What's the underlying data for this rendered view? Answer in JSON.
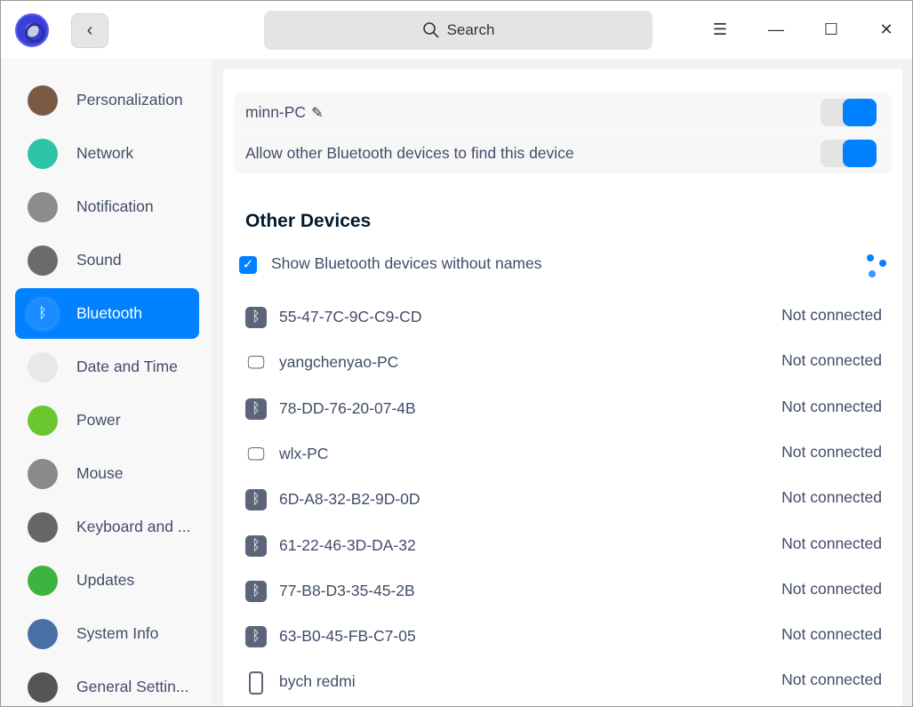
{
  "header": {
    "search_placeholder": "Search",
    "back": "‹",
    "menu": "☰",
    "minimize": "—",
    "maximize": "☐",
    "close": "✕"
  },
  "sidebar": {
    "items": [
      {
        "label": "Personalization",
        "icon": "personalization-icon",
        "color": "#7b5a44"
      },
      {
        "label": "Network",
        "icon": "network-icon",
        "color": "#2cc5a8"
      },
      {
        "label": "Notification",
        "icon": "notification-icon",
        "color": "#8c8c8c"
      },
      {
        "label": "Sound",
        "icon": "sound-icon",
        "color": "#6b6b6b"
      },
      {
        "label": "Bluetooth",
        "icon": "bluetooth-icon",
        "color": "#1a8cff"
      },
      {
        "label": "Date and Time",
        "icon": "clock-icon",
        "color": "#e8e8e8"
      },
      {
        "label": "Power",
        "icon": "battery-icon",
        "color": "#6cc62e"
      },
      {
        "label": "Mouse",
        "icon": "mouse-icon",
        "color": "#8a8a8a"
      },
      {
        "label": "Keyboard and ...",
        "icon": "keyboard-icon",
        "color": "#666666"
      },
      {
        "label": "Updates",
        "icon": "updates-icon",
        "color": "#3fb33f"
      },
      {
        "label": "System Info",
        "icon": "system-info-icon",
        "color": "#4a6fa5"
      },
      {
        "label": "General Settin...",
        "icon": "general-settings-icon",
        "color": "#555555"
      }
    ],
    "selected": 4
  },
  "bluetooth": {
    "device_name": "minn-PC",
    "name_enabled": true,
    "discoverable_label": "Allow other Bluetooth devices to find this device",
    "discoverable": true,
    "other_devices_title": "Other Devices",
    "show_unnamed_label": "Show Bluetooth devices without names",
    "show_unnamed": true,
    "devices": [
      {
        "name": "55-47-7C-9C-C9-CD",
        "type": "bluetooth",
        "status": "Not connected"
      },
      {
        "name": "yangchenyao-PC",
        "type": "computer",
        "status": "Not connected"
      },
      {
        "name": "78-DD-76-20-07-4B",
        "type": "bluetooth",
        "status": "Not connected"
      },
      {
        "name": "wlx-PC",
        "type": "computer",
        "status": "Not connected"
      },
      {
        "name": "6D-A8-32-B2-9D-0D",
        "type": "bluetooth",
        "status": "Not connected"
      },
      {
        "name": "61-22-46-3D-DA-32",
        "type": "bluetooth",
        "status": "Not connected"
      },
      {
        "name": "77-B8-D3-35-45-2B",
        "type": "bluetooth",
        "status": "Not connected"
      },
      {
        "name": "63-B0-45-FB-C7-05",
        "type": "bluetooth",
        "status": "Not connected"
      },
      {
        "name": "bych redmi",
        "type": "phone",
        "status": "Not connected"
      }
    ]
  },
  "colors": {
    "accent": "#0081ff"
  }
}
